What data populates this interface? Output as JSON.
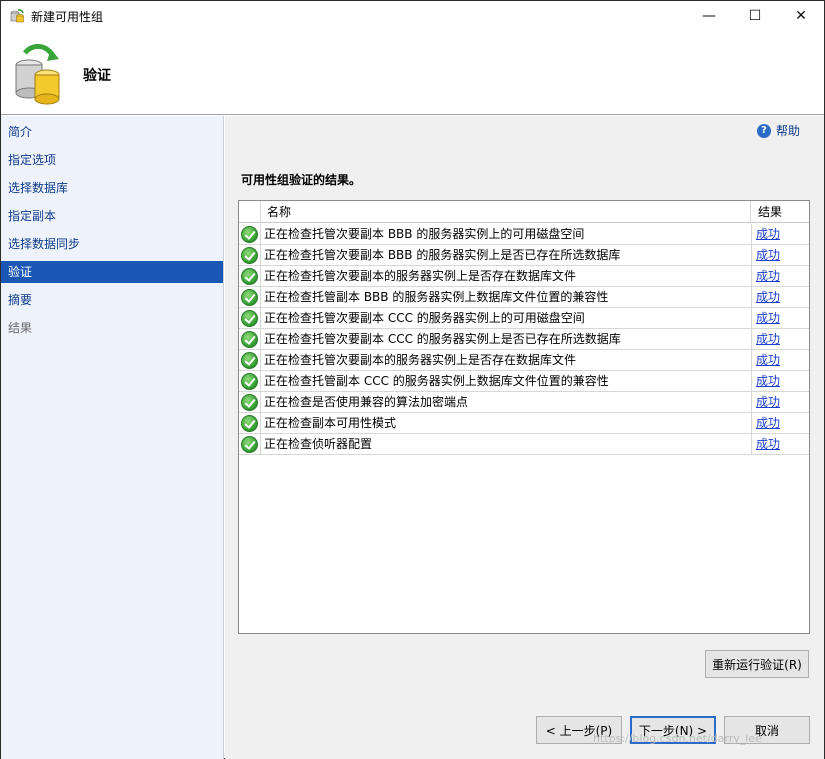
{
  "window": {
    "title": "新建可用性组"
  },
  "window_controls": {
    "minimize": "—",
    "maximize": "☐",
    "close": "✕"
  },
  "header": {
    "title": "验证"
  },
  "sidebar": {
    "items": [
      {
        "label": "简介",
        "state": "normal"
      },
      {
        "label": "指定选项",
        "state": "normal"
      },
      {
        "label": "选择数据库",
        "state": "normal"
      },
      {
        "label": "指定副本",
        "state": "normal"
      },
      {
        "label": "选择数据同步",
        "state": "normal"
      },
      {
        "label": "验证",
        "state": "active"
      },
      {
        "label": "摘要",
        "state": "normal"
      },
      {
        "label": "结果",
        "state": "disabled"
      }
    ]
  },
  "help": {
    "label": "帮助",
    "icon": "?"
  },
  "main": {
    "section_title": "可用性组验证的结果。",
    "table": {
      "columns": [
        "名称",
        "结果"
      ],
      "rows": [
        {
          "name": "正在检查托管次要副本 BBB 的服务器实例上的可用磁盘空间",
          "result": "成功"
        },
        {
          "name": "正在检查托管次要副本 BBB 的服务器实例上是否已存在所选数据库",
          "result": "成功"
        },
        {
          "name": "正在检查托管次要副本的服务器实例上是否存在数据库文件",
          "result": "成功"
        },
        {
          "name": "正在检查托管副本 BBB 的服务器实例上数据库文件位置的兼容性",
          "result": "成功"
        },
        {
          "name": "正在检查托管次要副本 CCC 的服务器实例上的可用磁盘空间",
          "result": "成功"
        },
        {
          "name": "正在检查托管次要副本 CCC 的服务器实例上是否已存在所选数据库",
          "result": "成功"
        },
        {
          "name": "正在检查托管次要副本的服务器实例上是否存在数据库文件",
          "result": "成功"
        },
        {
          "name": "正在检查托管副本 CCC 的服务器实例上数据库文件位置的兼容性",
          "result": "成功"
        },
        {
          "name": "正在检查是否使用兼容的算法加密端点",
          "result": "成功"
        },
        {
          "name": "正在检查副本可用性模式",
          "result": "成功"
        },
        {
          "name": "正在检查侦听器配置",
          "result": "成功"
        }
      ]
    },
    "rerun_button": "重新运行验证(R)"
  },
  "footer": {
    "prev_button": "< 上一步(P)",
    "next_button": "下一步(N) >",
    "cancel_button": "取消"
  },
  "watermark": "https://blog.csdn.net/darry_lee",
  "colors": {
    "accent": "#1b57b5",
    "sidebar_bg": "#eef3fb",
    "link": "#1a3fd0",
    "success": "#2f9a2f"
  }
}
